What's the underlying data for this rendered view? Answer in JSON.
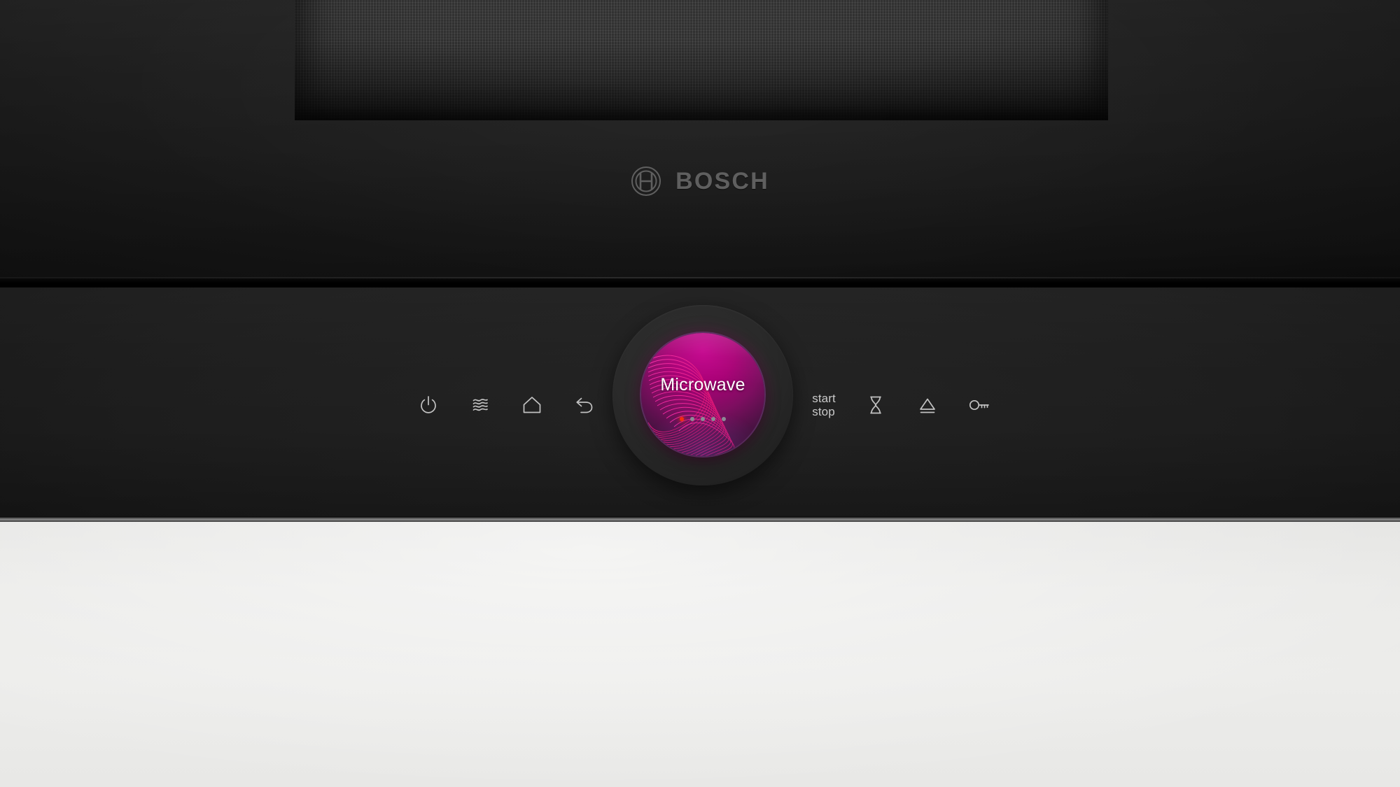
{
  "appliance": {
    "brand": "BOSCH",
    "brand_mark": "bosch-logo-icon",
    "product_type": "built-in microwave oven",
    "door_mesh": "perforated-mesh-screen"
  },
  "dial": {
    "label": "Microwave",
    "accent_color": "#c4008c",
    "rim_color": "#9646aa",
    "active_dot_color": "#f22d10",
    "inactive_dot_color": "#8b8b95",
    "pages": [
      {
        "active": true
      },
      {
        "active": false
      },
      {
        "active": false
      },
      {
        "active": false
      },
      {
        "active": false
      }
    ]
  },
  "controls": {
    "left": [
      {
        "name": "power-icon",
        "label": "power",
        "icon": "power"
      },
      {
        "name": "steam-waves-icon",
        "label": "steam",
        "icon": "waves"
      },
      {
        "name": "home-icon",
        "label": "home",
        "icon": "home"
      },
      {
        "name": "back-icon",
        "label": "back",
        "icon": "undo"
      }
    ],
    "right": [
      {
        "name": "start-stop-button",
        "label_line1": "start",
        "label_line2": "stop",
        "icon": "text"
      },
      {
        "name": "timer-hourglass-icon",
        "label": "timer",
        "icon": "hourglass"
      },
      {
        "name": "door-open-icon",
        "label": "door open",
        "icon": "eject"
      },
      {
        "name": "child-lock-key-icon",
        "label": "child lock",
        "icon": "key"
      }
    ]
  },
  "colors": {
    "panel_bg": "#1d1d1d",
    "door_bg": "#1c1c1c",
    "icon_stroke": "#c2c2c2",
    "logo_gray": "#6e6e6e",
    "counter": "#eaeae8"
  }
}
